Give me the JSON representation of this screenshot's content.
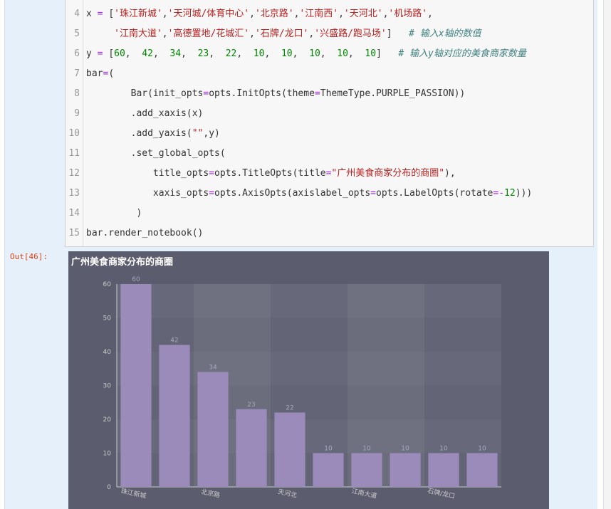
{
  "code": {
    "lines": [
      {
        "n": "4",
        "parts": [
          [
            "x ",
            ""
          ],
          [
            "= ",
            "kw-op"
          ],
          [
            "[",
            ""
          ],
          [
            "'珠江新城'",
            "str"
          ],
          [
            ",",
            ""
          ],
          [
            "'天河城/体育中心'",
            "str"
          ],
          [
            ",",
            ""
          ],
          [
            "'北京路'",
            "str"
          ],
          [
            ",",
            ""
          ],
          [
            "'江南西'",
            "str"
          ],
          [
            ",",
            ""
          ],
          [
            "'天河北'",
            "str"
          ],
          [
            ",",
            ""
          ],
          [
            "'机场路'",
            "str"
          ],
          [
            ",",
            ""
          ]
        ]
      },
      {
        "n": "5",
        "parts": [
          [
            "     ",
            ""
          ],
          [
            "'江南大道'",
            "str"
          ],
          [
            ",",
            ""
          ],
          [
            "'高德置地/花城汇'",
            "str"
          ],
          [
            ",",
            ""
          ],
          [
            "'石牌/龙口'",
            "str"
          ],
          [
            ",",
            ""
          ],
          [
            "'兴盛路/跑马场'",
            "str"
          ],
          [
            "]   ",
            ""
          ],
          [
            "# 输入x轴的数值",
            "cm"
          ]
        ]
      },
      {
        "n": "6",
        "parts": [
          [
            "y ",
            ""
          ],
          [
            "= ",
            "kw-op"
          ],
          [
            "[",
            ""
          ],
          [
            "60",
            "num"
          ],
          [
            ",  ",
            ""
          ],
          [
            "42",
            "num"
          ],
          [
            ",  ",
            ""
          ],
          [
            "34",
            "num"
          ],
          [
            ",  ",
            ""
          ],
          [
            "23",
            "num"
          ],
          [
            ",  ",
            ""
          ],
          [
            "22",
            "num"
          ],
          [
            ",  ",
            ""
          ],
          [
            "10",
            "num"
          ],
          [
            ",  ",
            ""
          ],
          [
            "10",
            "num"
          ],
          [
            ",  ",
            ""
          ],
          [
            "10",
            "num"
          ],
          [
            ",  ",
            ""
          ],
          [
            "10",
            "num"
          ],
          [
            ",  ",
            ""
          ],
          [
            "10",
            "num"
          ],
          [
            "]   ",
            ""
          ],
          [
            "# 输入y轴对应的美食商家数量",
            "cm"
          ]
        ]
      },
      {
        "n": "7",
        "parts": [
          [
            "bar",
            ""
          ],
          [
            "=",
            "kw-op"
          ],
          [
            "(",
            ""
          ]
        ]
      },
      {
        "n": "8",
        "parts": [
          [
            "        Bar(init_opts",
            ""
          ],
          [
            "=",
            "kw-op"
          ],
          [
            "opts.InitOpts(theme",
            ""
          ],
          [
            "=",
            "kw-op"
          ],
          [
            "ThemeType.PURPLE_PASSION))",
            ""
          ]
        ]
      },
      {
        "n": "9",
        "parts": [
          [
            "        .add_xaxis(x)",
            ""
          ]
        ]
      },
      {
        "n": "10",
        "parts": [
          [
            "        .add_yaxis(",
            ""
          ],
          [
            "\"\"",
            "str"
          ],
          [
            ",y)",
            ""
          ]
        ]
      },
      {
        "n": "11",
        "parts": [
          [
            "        .set_global_opts(",
            ""
          ]
        ]
      },
      {
        "n": "12",
        "parts": [
          [
            "            title_opts",
            ""
          ],
          [
            "=",
            "kw-op"
          ],
          [
            "opts.TitleOpts(title",
            ""
          ],
          [
            "=",
            "kw-op"
          ],
          [
            "\"广州美食商家分布的商圈\"",
            "str"
          ],
          [
            "),",
            ""
          ]
        ]
      },
      {
        "n": "13",
        "parts": [
          [
            "            xaxis_opts",
            ""
          ],
          [
            "=",
            "kw-op"
          ],
          [
            "opts.AxisOpts(axislabel_opts",
            ""
          ],
          [
            "=",
            "kw-op"
          ],
          [
            "opts.LabelOpts(rotate",
            ""
          ],
          [
            "=-",
            "kw-op"
          ],
          [
            "12",
            "num"
          ],
          [
            ")))",
            ""
          ]
        ]
      },
      {
        "n": "14",
        "parts": [
          [
            "         )",
            ""
          ]
        ]
      },
      {
        "n": "15",
        "parts": [
          [
            "bar.render_notebook()",
            ""
          ]
        ]
      }
    ]
  },
  "output_prompt": "Out[46]:",
  "chart_data": {
    "type": "bar",
    "title": "广州美食商家分布的商圈",
    "categories": [
      "珠江新城",
      "天河城/体育中心",
      "北京路",
      "江南西",
      "天河北",
      "机场路",
      "江南大道",
      "高德置地/花城汇",
      "石牌/龙口",
      "兴盛路/跑马场"
    ],
    "visible_x_tick_labels": [
      "珠江新城",
      "北京路",
      "天河北",
      "江南大道",
      "石牌/龙口"
    ],
    "series": [
      {
        "values": [
          60,
          42,
          34,
          23,
          22,
          10,
          10,
          10,
          10,
          10
        ]
      }
    ],
    "ylim": [
      0,
      60
    ],
    "y_ticks": [
      0,
      10,
      20,
      30,
      40,
      50,
      60
    ],
    "xlabel": "",
    "ylabel": "",
    "x_label_rotate": -12,
    "colors": {
      "bar": "#9b8bba",
      "background": "#5b5c6e",
      "label": "#cccccc",
      "axis": "#cccccc",
      "title": "#ffffff"
    }
  }
}
